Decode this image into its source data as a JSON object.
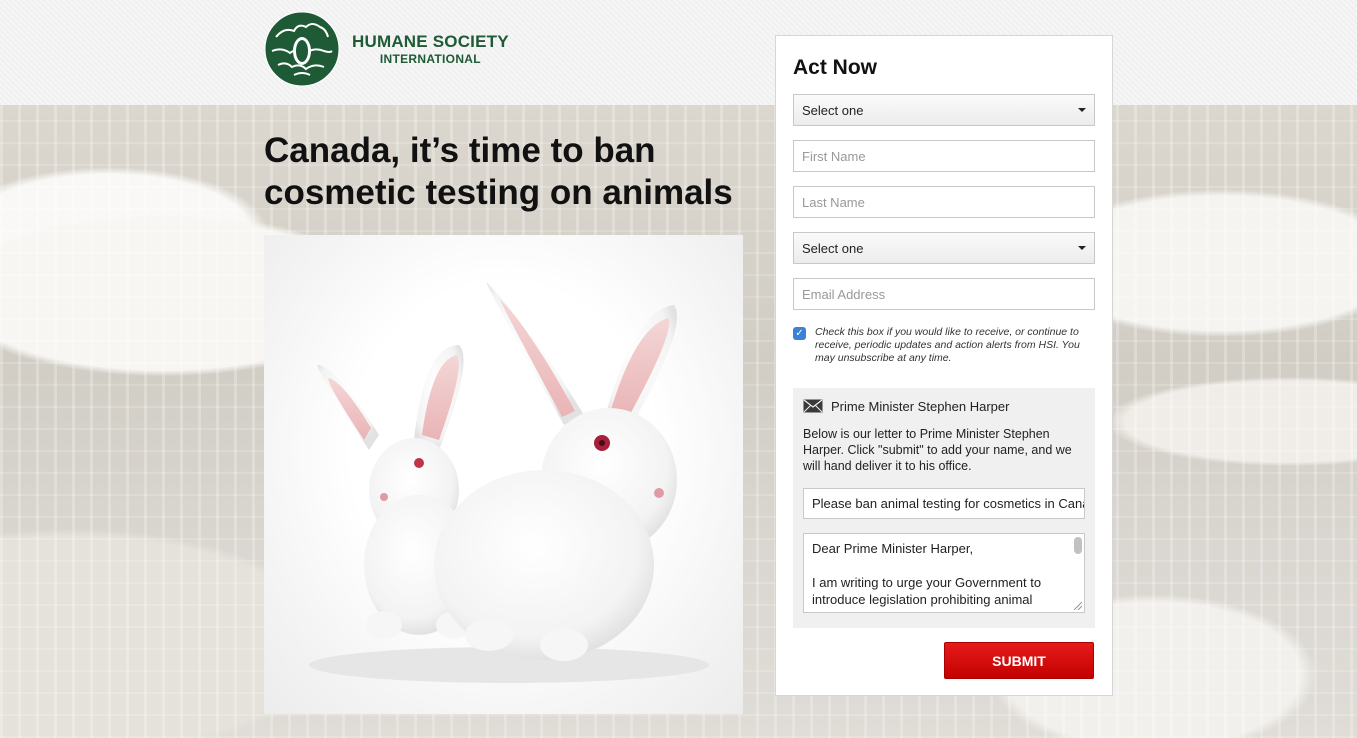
{
  "brand": {
    "name_line1": "HUMANE SOCIETY",
    "name_line2": "INTERNATIONAL",
    "logo_color": "#1e5a35"
  },
  "headline": "Canada, it’s time to ban cosmetic testing on animals",
  "form": {
    "title": "Act Now",
    "title_select": {
      "value": "Select one"
    },
    "first_name": {
      "placeholder": "First Name"
    },
    "last_name": {
      "placeholder": "Last Name"
    },
    "country_select": {
      "value": "Select one"
    },
    "email": {
      "placeholder": "Email Address"
    },
    "optin": {
      "checked": true,
      "text": "Check this box if you would like to receive, or continue to receive, periodic updates and action alerts from HSI. You may unsubscribe at any time."
    },
    "letter": {
      "recipient": "Prime Minister Stephen Harper",
      "intro": "Below is our letter to Prime Minister Stephen Harper. Click \"submit\" to add your name, and we will hand deliver it to his office.",
      "subject": "Please ban animal testing for cosmetics in Canada",
      "salutation": "Dear Prime Minister Harper,",
      "body_line": "I am writing to urge your Government to introduce legislation prohibiting animal"
    },
    "submit_label": "SUBMIT",
    "submit_color": "#d20a0a"
  },
  "icons": {
    "logo": "globe-with-animals-icon",
    "recipient": "envelope-icon",
    "select": "chevron-down-icon",
    "checkbox": "checkmark-icon"
  }
}
